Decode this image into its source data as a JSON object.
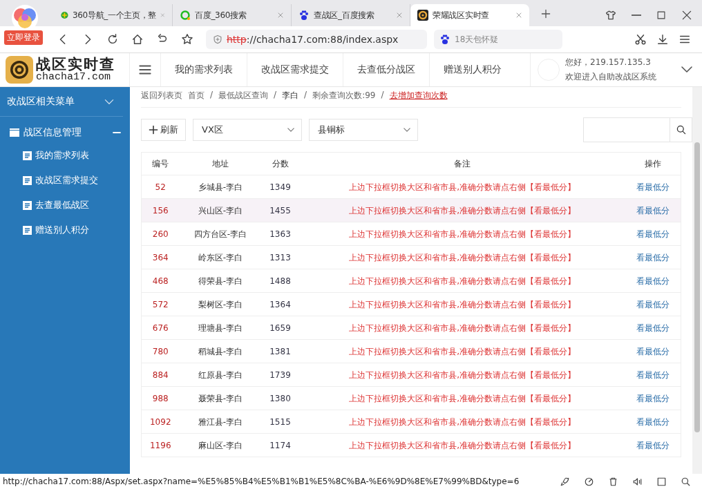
{
  "browser": {
    "login_badge": "立即登录",
    "tabs": [
      {
        "title": "360导航_一个主页，整",
        "selected": false,
        "kind": "nav360"
      },
      {
        "title": "百度_360搜索",
        "selected": false,
        "kind": "so"
      },
      {
        "title": "查战区_百度搜索",
        "selected": false,
        "kind": "baidu"
      },
      {
        "title": "荣耀战区实时查",
        "selected": true,
        "kind": "site"
      }
    ],
    "address": {
      "scheme": "http",
      "rest": "://chacha17.com:88/index.aspx"
    },
    "search_hint": "18天包怀疑"
  },
  "header": {
    "logo_title": "战区实时查",
    "logo_domain": "chacha17.com",
    "nav": [
      "我的需求列表",
      "改战区需求提交",
      "去查低分战区",
      "赠送别人积分"
    ],
    "greeting": "您好，219.157.135.3",
    "welcome": "欢迎进入自助改战区系统"
  },
  "sidebar": {
    "section": "改战区相关菜单",
    "group": {
      "label": "战区信息管理",
      "expanded": true,
      "children": [
        "我的需求列表",
        "改战区需求提交",
        "去查最低战区",
        "赠送别人积分"
      ]
    }
  },
  "breadcrumb": {
    "back": "返回列表页",
    "separator": "/",
    "items": [
      "首页",
      "最低战区查询",
      "李白",
      "剩余查询次数:99"
    ],
    "link": "去增加查询次数"
  },
  "toolbar": {
    "refresh": "刷新",
    "region": "VX区",
    "badge": "县铜标"
  },
  "table": {
    "columns": [
      "编号",
      "地址",
      "分数",
      "备注",
      "操作"
    ],
    "rows": [
      {
        "id": "52",
        "address": "乡城县-李白",
        "score": "1349",
        "note": "上边下拉框切换大区和省市县,准确分数请点右侧【看最低分】",
        "action": "看最低分",
        "hover": false
      },
      {
        "id": "156",
        "address": "兴山区-李白",
        "score": "1455",
        "note": "上边下拉框切换大区和省市县,准确分数请点右侧【看最低分】",
        "action": "看最低分",
        "hover": true
      },
      {
        "id": "260",
        "address": "四方台区-李白",
        "score": "1363",
        "note": "上边下拉框切换大区和省市县,准确分数请点右侧【看最低分】",
        "action": "看最低分",
        "hover": false
      },
      {
        "id": "364",
        "address": "岭东区-李白",
        "score": "1313",
        "note": "上边下拉框切换大区和省市县,准确分数请点右侧【看最低分】",
        "action": "看最低分",
        "hover": false
      },
      {
        "id": "468",
        "address": "得荣县-李白",
        "score": "1488",
        "note": "上边下拉框切换大区和省市县,准确分数请点右侧【看最低分】",
        "action": "看最低分",
        "hover": false
      },
      {
        "id": "572",
        "address": "梨树区-李白",
        "score": "1364",
        "note": "上边下拉框切换大区和省市县,准确分数请点右侧【看最低分】",
        "action": "看最低分",
        "hover": false
      },
      {
        "id": "676",
        "address": "理塘县-李白",
        "score": "1659",
        "note": "上边下拉框切换大区和省市县,准确分数请点右侧【看最低分】",
        "action": "看最低分",
        "hover": false
      },
      {
        "id": "780",
        "address": "稻城县-李白",
        "score": "1381",
        "note": "上边下拉框切换大区和省市县,准确分数请点右侧【看最低分】",
        "action": "看最低分",
        "hover": false
      },
      {
        "id": "884",
        "address": "红原县-李白",
        "score": "1739",
        "note": "上边下拉框切换大区和省市县,准确分数请点右侧【看最低分】",
        "action": "看最低分",
        "hover": false
      },
      {
        "id": "988",
        "address": "聂荣县-李白",
        "score": "1380",
        "note": "上边下拉框切换大区和省市县,准确分数请点右侧【看最低分】",
        "action": "看最低分",
        "hover": false
      },
      {
        "id": "1092",
        "address": "雅江县-李白",
        "score": "1515",
        "note": "上边下拉框切换大区和省市县,准确分数请点右侧【看最低分】",
        "action": "看最低分",
        "hover": false
      },
      {
        "id": "1196",
        "address": "麻山区-李白",
        "score": "1174",
        "note": "上边下拉框切换大区和省市县,准确分数请点右侧【看最低分】",
        "action": "看最低分",
        "hover": false
      }
    ]
  },
  "status_url": "http://chacha17.com:88/Aspx/set.aspx?name=%E5%85%B4%E5%B1%B1%E5%8C%BA-%E6%9D%8E%E7%99%BD&type=6"
}
